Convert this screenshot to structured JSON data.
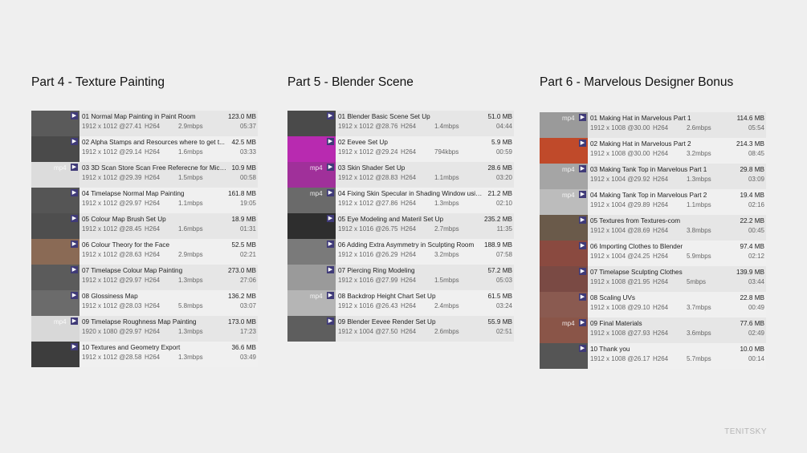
{
  "watermark": "TENITSKY",
  "columns": [
    {
      "title": "Part 4 - Texture Painting",
      "items": [
        {
          "name": "01 Normal Map Painting in Paint Room",
          "size": "123.0 MB",
          "res": "1912 x 1012 @27.41",
          "codec": "H264",
          "bitrate": "2.9mbps",
          "dur": "05:37",
          "thumb": "#5a5a5a",
          "mp4": ""
        },
        {
          "name": "02 Alpha Stamps and Resources where to get t...",
          "size": "42.5 MB",
          "res": "1912 x 1012 @29.14",
          "codec": "H264",
          "bitrate": "1.6mbps",
          "dur": "03:33",
          "thumb": "#4a4a4a",
          "mp4": ""
        },
        {
          "name": "03 3D Scan Store Scan Free Referecne for Micr...",
          "size": "10.9 MB",
          "res": "1912 x 1012 @29.39",
          "codec": "H264",
          "bitrate": "1.5mbps",
          "dur": "00:58",
          "thumb": "#dcdcdc",
          "mp4": "mp4"
        },
        {
          "name": "04 Timelapse Normal Map Painting",
          "size": "161.8 MB",
          "res": "1912 x 1012 @29.97",
          "codec": "H264",
          "bitrate": "1.1mbps",
          "dur": "19:05",
          "thumb": "#555555",
          "mp4": ""
        },
        {
          "name": "05 Colour Map Brush Set Up",
          "size": "18.9 MB",
          "res": "1912 x 1012 @28.45",
          "codec": "H264",
          "bitrate": "1.6mbps",
          "dur": "01:31",
          "thumb": "#4e4e4e",
          "mp4": ""
        },
        {
          "name": "06 Colour Theory for the Face",
          "size": "52.5 MB",
          "res": "1912 x 1012 @28.63",
          "codec": "H264",
          "bitrate": "2.9mbps",
          "dur": "02:21",
          "thumb": "#8a6a55",
          "mp4": ""
        },
        {
          "name": "07 Timelapse Colour Map Painting",
          "size": "273.0 MB",
          "res": "1912 x 1012 @29.97",
          "codec": "H264",
          "bitrate": "1.3mbps",
          "dur": "27:06",
          "thumb": "#5b5b5b",
          "mp4": ""
        },
        {
          "name": "08 Glossiness Map",
          "size": "136.2 MB",
          "res": "1912 x 1012 @28.03",
          "codec": "H264",
          "bitrate": "5.8mbps",
          "dur": "03:07",
          "thumb": "#6b6b6b",
          "mp4": ""
        },
        {
          "name": "09 Timelapse Roughness Map Painting",
          "size": "173.0 MB",
          "res": "1920 x 1080 @29.97",
          "codec": "H264",
          "bitrate": "1.3mbps",
          "dur": "17:23",
          "thumb": "#d8d8d8",
          "mp4": "mp4"
        },
        {
          "name": "10 Textures and Geometry Export",
          "size": "36.6 MB",
          "res": "1912 x 1012 @28.58",
          "codec": "H264",
          "bitrate": "1.3mbps",
          "dur": "03:49",
          "thumb": "#3d3d3d",
          "mp4": ""
        }
      ]
    },
    {
      "title": "Part 5 - Blender Scene",
      "items": [
        {
          "name": "01 Blender Basic Scene Set Up",
          "size": "51.0 MB",
          "res": "1912 x 1012 @28.76",
          "codec": "H264",
          "bitrate": "1.4mbps",
          "dur": "04:44",
          "thumb": "#4a4a4a",
          "mp4": ""
        },
        {
          "name": "02 Eevee Set Up",
          "size": "5.9 MB",
          "res": "1912 x 1012 @29.24",
          "codec": "H264",
          "bitrate": "794kbps",
          "dur": "00:59",
          "thumb": "#b82ab0",
          "mp4": ""
        },
        {
          "name": "03 Skin Shader Set Up",
          "size": "28.6 MB",
          "res": "1912 x 1012 @28.83",
          "codec": "H264",
          "bitrate": "1.1mbps",
          "dur": "03:20",
          "thumb": "#a0309a",
          "mp4": "mp4"
        },
        {
          "name": "04 Fixing Skin Specular in Shading Window usin...",
          "size": "21.2 MB",
          "res": "1912 x 1012 @27.86",
          "codec": "H264",
          "bitrate": "1.3mbps",
          "dur": "02:10",
          "thumb": "#6a6a6a",
          "mp4": "mp4"
        },
        {
          "name": "05 Eye Modeling and Materil Set Up",
          "size": "235.2 MB",
          "res": "1912 x 1016 @26.75",
          "codec": "H264",
          "bitrate": "2.7mbps",
          "dur": "11:35",
          "thumb": "#2e2e2e",
          "mp4": ""
        },
        {
          "name": "06 Adding Extra Asymmetry in Sculpting Room",
          "size": "188.9 MB",
          "res": "1912 x 1016 @26.29",
          "codec": "H264",
          "bitrate": "3.2mbps",
          "dur": "07:58",
          "thumb": "#7a7a7a",
          "mp4": ""
        },
        {
          "name": "07 Piercing Ring Modeling",
          "size": "57.2 MB",
          "res": "1912 x 1016 @27.99",
          "codec": "H264",
          "bitrate": "1.5mbps",
          "dur": "05:03",
          "thumb": "#9a9a9a",
          "mp4": ""
        },
        {
          "name": "08 Backdrop Height Chart Set Up",
          "size": "61.5 MB",
          "res": "1912 x 1016 @26.43",
          "codec": "H264",
          "bitrate": "2.4mbps",
          "dur": "03:24",
          "thumb": "#b5b5b5",
          "mp4": "mp4"
        },
        {
          "name": "09 Blender Eevee Render Set Up",
          "size": "55.9 MB",
          "res": "1912 x 1004 @27.50",
          "codec": "H264",
          "bitrate": "2.6mbps",
          "dur": "02:51",
          "thumb": "#5e5e5e",
          "mp4": ""
        }
      ]
    },
    {
      "title": "Part 6 - Marvelous Designer Bonus",
      "items": [
        {
          "name": "01 Making Hat in Marvelous Part 1",
          "size": "114.6 MB",
          "res": "1912 x 1008 @30.00",
          "codec": "H264",
          "bitrate": "2.6mbps",
          "dur": "05:54",
          "thumb": "#9a9a9a",
          "mp4": "mp4"
        },
        {
          "name": "02 Making Hat in Marvelous Part 2",
          "size": "214.3 MB",
          "res": "1912 x 1008 @30.00",
          "codec": "H264",
          "bitrate": "3.2mbps",
          "dur": "08:45",
          "thumb": "#c04a2a",
          "mp4": ""
        },
        {
          "name": "03 Making Tank Top in Marvelous Part 1",
          "size": "29.8 MB",
          "res": "1912 x 1004 @29.92",
          "codec": "H264",
          "bitrate": "1.3mbps",
          "dur": "03:09",
          "thumb": "#a5a5a5",
          "mp4": "mp4"
        },
        {
          "name": "04 Making Tank Top in Marvelous Part 2",
          "size": "19.4 MB",
          "res": "1912 x 1004 @29.89",
          "codec": "H264",
          "bitrate": "1.1mbps",
          "dur": "02:16",
          "thumb": "#bcbcbc",
          "mp4": "mp4"
        },
        {
          "name": "05 Textures from Textures-com",
          "size": "22.2 MB",
          "res": "1912 x 1004 @28.69",
          "codec": "H264",
          "bitrate": "3.8mbps",
          "dur": "00:45",
          "thumb": "#6a5a4a",
          "mp4": ""
        },
        {
          "name": "06 Importing Clothes to Blender",
          "size": "97.4 MB",
          "res": "1912 x 1004 @24.25",
          "codec": "H264",
          "bitrate": "5.9mbps",
          "dur": "02:12",
          "thumb": "#8a4a40",
          "mp4": ""
        },
        {
          "name": "07 Timelapse Sculpting Clothes",
          "size": "139.9 MB",
          "res": "1912 x 1008 @21.95",
          "codec": "H264",
          "bitrate": "5mbps",
          "dur": "03:44",
          "thumb": "#7a4a44",
          "mp4": ""
        },
        {
          "name": "08 Scaling UVs",
          "size": "22.8 MB",
          "res": "1912 x 1008 @29.10",
          "codec": "H264",
          "bitrate": "3.7mbps",
          "dur": "00:49",
          "thumb": "#8a5a50",
          "mp4": ""
        },
        {
          "name": "09 Final Materials",
          "size": "77.6 MB",
          "res": "1912 x 1008 @27.93",
          "codec": "H264",
          "bitrate": "3.6mbps",
          "dur": "02:49",
          "thumb": "#8a5548",
          "mp4": "mp4"
        },
        {
          "name": "10 Thank you",
          "size": "10.0 MB",
          "res": "1912 x 1008 @26.17",
          "codec": "H264",
          "bitrate": "5.7mbps",
          "dur": "00:14",
          "thumb": "#555555",
          "mp4": ""
        }
      ]
    }
  ]
}
